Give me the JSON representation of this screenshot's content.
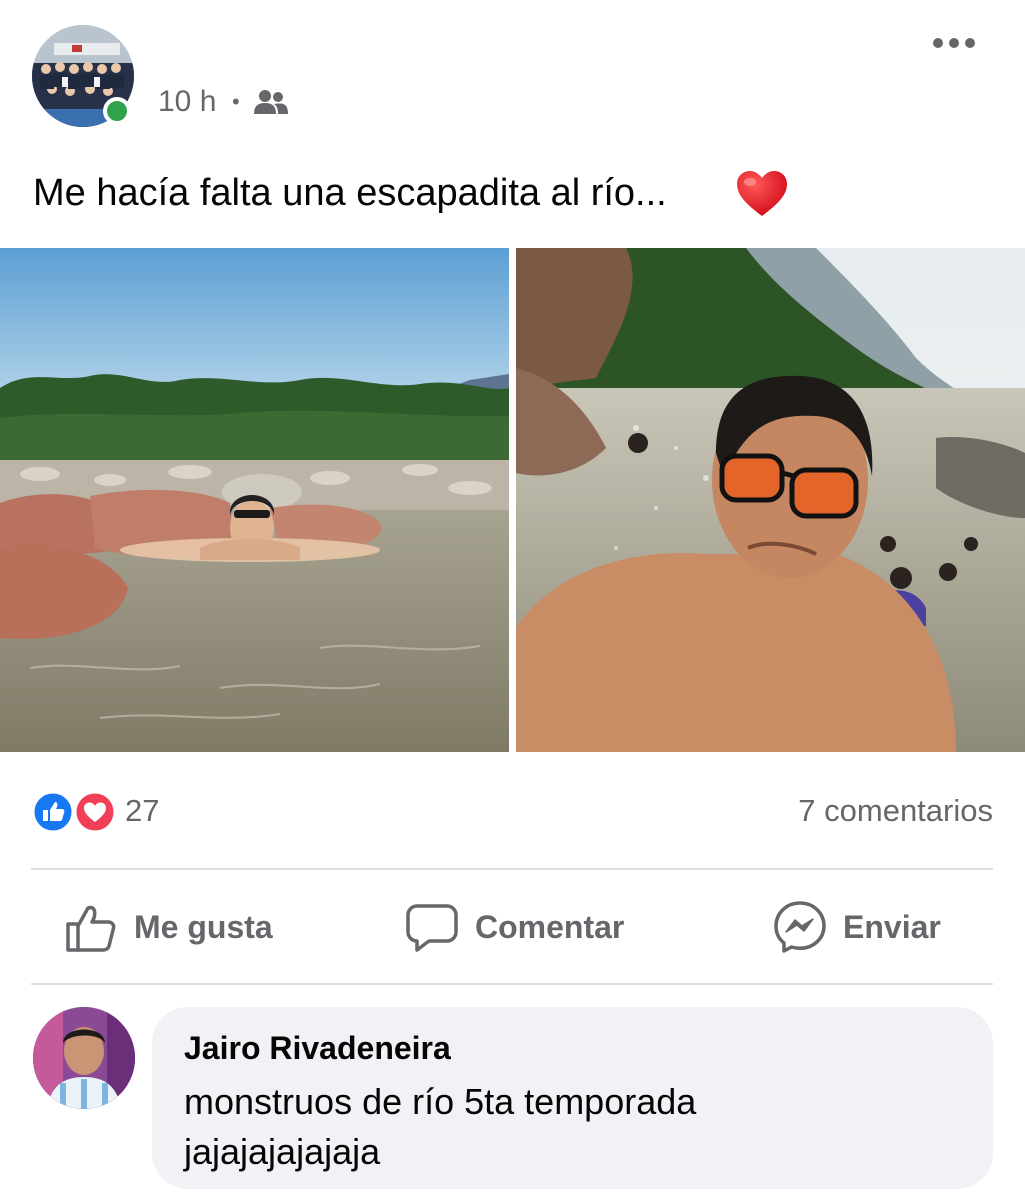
{
  "post": {
    "time": "10 h",
    "separator": "•",
    "audience_icon": "friends-icon",
    "more_icon": "more-horizontal-icon",
    "caption": "Me hacía falta una escapadita al río...",
    "caption_emoji": "red-heart-icon"
  },
  "photos": [
    {
      "name": "photo-man-in-river"
    },
    {
      "name": "photo-river-selfie"
    }
  ],
  "reactions": {
    "icons": [
      "like-reaction-icon",
      "love-reaction-icon"
    ],
    "count": "27",
    "comments": "7 comentarios"
  },
  "actions": {
    "like": "Me gusta",
    "comment": "Comentar",
    "send": "Enviar"
  },
  "comment": {
    "author": "Jairo Rivadeneira",
    "line1": "monstruos de río 5ta temporada",
    "line2": "jajajajajajaja"
  },
  "colors": {
    "facebook_blue": "#1877f2",
    "love_red": "#f33e58",
    "online_green": "#31a24c",
    "secondary_text": "#65676b",
    "bubble_bg": "#f0f2f5"
  }
}
